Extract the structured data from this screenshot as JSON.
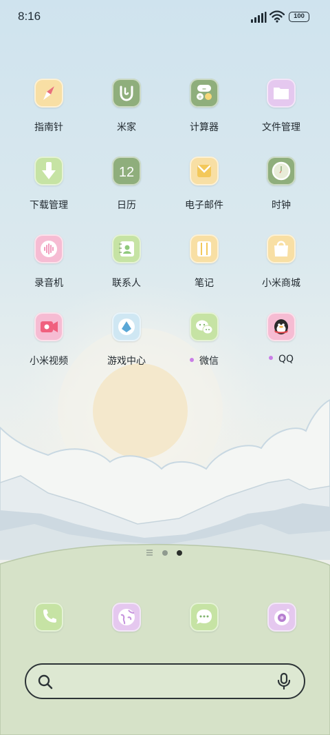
{
  "status_bar": {
    "time": "8:16",
    "battery": "100",
    "icons": [
      "signal-icon",
      "wifi-icon",
      "battery-icon"
    ]
  },
  "home": {
    "apps": [
      {
        "label": "指南针",
        "icon": "compass-icon",
        "color": "#f8dfa4"
      },
      {
        "label": "米家",
        "icon": "mijia-icon",
        "color": "#8fae7c"
      },
      {
        "label": "计算器",
        "icon": "calculator-icon",
        "color": "#8fae7c"
      },
      {
        "label": "文件管理",
        "icon": "folder-icon",
        "color": "#e5c8ef"
      },
      {
        "label": "下载管理",
        "icon": "download-icon",
        "color": "#c6e3a4"
      },
      {
        "label": "日历",
        "icon": "calendar-icon",
        "number": "12",
        "color": "#8fae7c"
      },
      {
        "label": "电子邮件",
        "icon": "mail-icon",
        "color": "#f8dfa4"
      },
      {
        "label": "时钟",
        "icon": "clock-icon",
        "color": "#8fae7c"
      },
      {
        "label": "录音机",
        "icon": "recorder-icon",
        "color": "#f6bcd3"
      },
      {
        "label": "联系人",
        "icon": "contacts-icon",
        "color": "#c6e3a4"
      },
      {
        "label": "笔记",
        "icon": "notes-icon",
        "color": "#f8dfa4"
      },
      {
        "label": "小米商城",
        "icon": "shopping-bag-icon",
        "color": "#f8dfa4"
      },
      {
        "label": "小米视频",
        "icon": "video-icon",
        "color": "#f6bcd3"
      },
      {
        "label": "游戏中心",
        "icon": "game-center-icon",
        "color": "#cfe7f3"
      },
      {
        "label": "微信",
        "icon": "wechat-icon",
        "color": "#c6e3a4",
        "new_badge": true
      },
      {
        "label": "QQ",
        "icon": "qq-penguin-icon",
        "color": "#f6bcd3",
        "new_badge": true
      }
    ]
  },
  "pager": {
    "pages": 2,
    "current": 2,
    "colors": {
      "inactive": "#8f9a8f",
      "active": "#2b2f2c"
    }
  },
  "dock": {
    "apps": [
      {
        "icon": "phone-icon",
        "color": "#c6e3a4"
      },
      {
        "icon": "browser-globe-icon",
        "color": "#e5c8ef"
      },
      {
        "icon": "messages-icon",
        "color": "#c6e3a4"
      },
      {
        "icon": "camera-icon",
        "color": "#e5c8ef"
      }
    ]
  },
  "search": {
    "placeholder": "",
    "icons": [
      "search-icon",
      "microphone-icon"
    ]
  },
  "theme": {
    "sky": "#cfe3ee",
    "sun": "#f4e8cc",
    "ground": "#d6e2c8",
    "text": "#222a30"
  }
}
